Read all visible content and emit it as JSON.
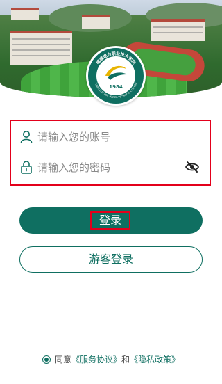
{
  "header": {
    "emblem_year": "1984",
    "emblem_ring_text": "FUJIAN ELECTRIC POWER TECHNICAL COLLEGE",
    "emblem_cn_text": "福建电力职业技术学院"
  },
  "login": {
    "account_placeholder": "请输入您的账号",
    "account_value": "",
    "password_placeholder": "请输入您的密码",
    "password_value": "",
    "submit_label": "登录",
    "guest_label": "游客登录"
  },
  "agreement": {
    "agree_text": "同意",
    "service_link": "《服务协议》",
    "and_text": "和",
    "privacy_link": "《隐私政策》",
    "checked": true
  },
  "colors": {
    "primary": "#0f6f61",
    "highlight": "#e3001b"
  },
  "icons": {
    "account": "user-icon",
    "password": "lock-icon",
    "visibility": "eye-off-icon"
  }
}
